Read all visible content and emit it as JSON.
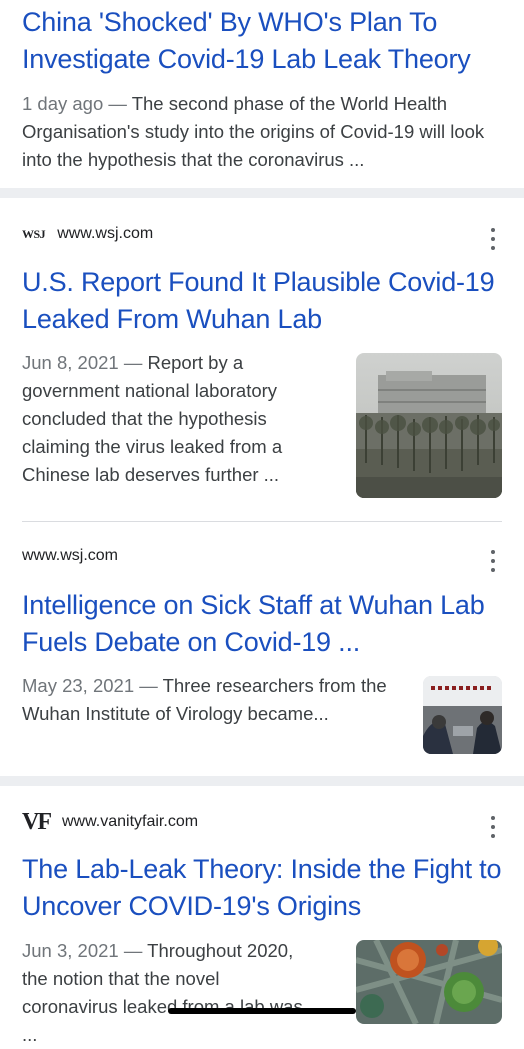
{
  "results": [
    {
      "title": "China 'Shocked' By WHO's Plan To Investigate Covid-19 Lab Leak Theory",
      "date": "1 day ago",
      "separator": "—",
      "snippet": "The second phase of the World Health Organisation's study into the origins of Covid-19 will look into the hypothesis that the coronavirus ..."
    },
    {
      "favicon": "WSJ",
      "domain": "www.wsj.com",
      "title": "U.S. Report Found It Plausible Covid-19 Leaked From Wuhan Lab",
      "date": "Jun 8, 2021",
      "separator": "—",
      "snippet": "Report by a government national laboratory concluded that the hypothesis claiming the virus leaked from a Chinese lab deserves further ..."
    },
    {
      "domain": "www.wsj.com",
      "title": "Intelligence on Sick Staff at Wuhan Lab Fuels Debate on Covid-19 ...",
      "date": "May 23, 2021",
      "separator": "—",
      "snippet": "Three researchers from the Wuhan Institute of Virology became..."
    },
    {
      "favicon": "VF",
      "domain": "www.vanityfair.com",
      "title": "The Lab-Leak Theory: Inside the Fight to Uncover COVID-19's Origins",
      "date": "Jun 3, 2021",
      "separator": "—",
      "snippet": "Throughout 2020, the notion that the novel coronavirus leaked from a lab was ..."
    }
  ],
  "icons": {
    "more": "more-vert-icon"
  },
  "colors": {
    "link": "#1a4fbf",
    "text": "#3c4043",
    "muted": "#70757a",
    "separator_band": "#eceef1"
  }
}
